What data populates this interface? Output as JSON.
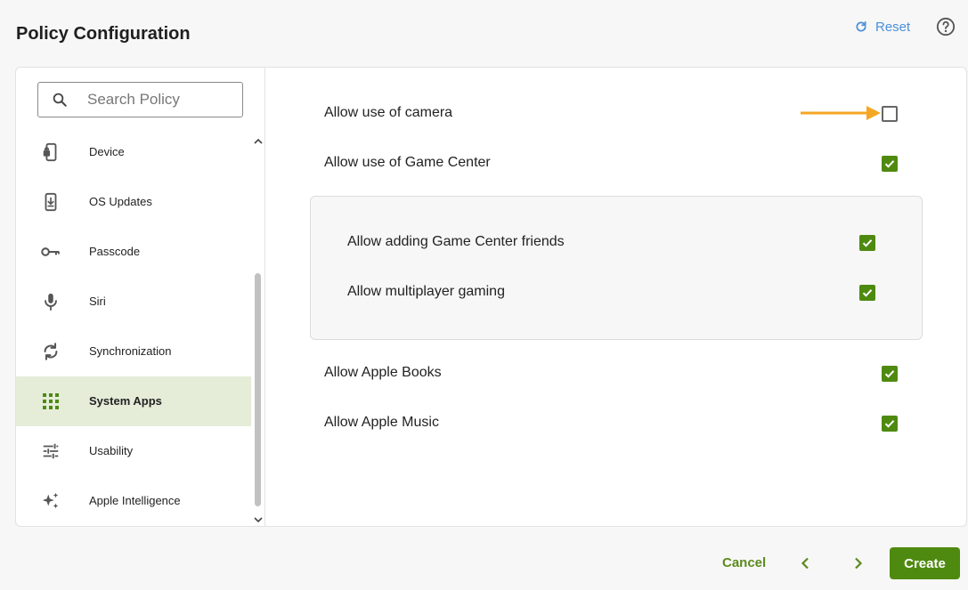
{
  "header": {
    "title": "Policy Configuration",
    "reset_label": "Reset"
  },
  "search": {
    "placeholder": "Search Policy",
    "value": ""
  },
  "sidebar": {
    "items": [
      {
        "label": "Device",
        "icon": "device-lock-icon",
        "active": false
      },
      {
        "label": "OS Updates",
        "icon": "phone-download-icon",
        "active": false
      },
      {
        "label": "Passcode",
        "icon": "key-icon",
        "active": false
      },
      {
        "label": "Siri",
        "icon": "microphone-icon",
        "active": false
      },
      {
        "label": "Synchronization",
        "icon": "sync-icon",
        "active": false
      },
      {
        "label": "System Apps",
        "icon": "apps-grid-icon",
        "active": true
      },
      {
        "label": "Usability",
        "icon": "sliders-icon",
        "active": false
      },
      {
        "label": "Apple Intelligence",
        "icon": "sparkles-icon",
        "active": false
      }
    ]
  },
  "settings": {
    "camera": {
      "label": "Allow use of camera",
      "checked": false
    },
    "game_center": {
      "label": "Allow use of Game Center",
      "checked": true
    },
    "game_center_friends": {
      "label": "Allow adding Game Center friends",
      "checked": true
    },
    "multiplayer": {
      "label": "Allow multiplayer gaming",
      "checked": true
    },
    "apple_books": {
      "label": "Allow Apple Books",
      "checked": true
    },
    "apple_music": {
      "label": "Allow Apple Music",
      "checked": true
    }
  },
  "footer": {
    "cancel_label": "Cancel",
    "create_label": "Create"
  },
  "colors": {
    "accent_green": "#4f8a10",
    "active_bg": "#e5edd9",
    "link_blue": "#4a90d9",
    "annotation_orange": "#f5a623"
  }
}
